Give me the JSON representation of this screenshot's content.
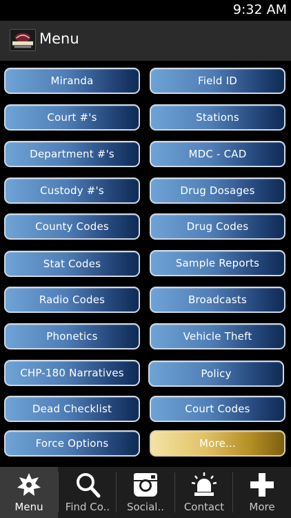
{
  "status_bar": {
    "time": "9:32 AM"
  },
  "action_bar": {
    "title": "Menu"
  },
  "menu": {
    "items": [
      "Miranda",
      "Field ID",
      "Court #'s",
      "Stations",
      "Department #'s",
      "MDC - CAD",
      "Custody #'s",
      "Drug Dosages",
      "County Codes",
      "Drug Codes",
      "Stat Codes",
      "Sample Reports",
      "Radio Codes",
      "Broadcasts",
      "Phonetics",
      "Vehicle Theft",
      "CHP-180 Narratives",
      "Policy",
      "Dead Checklist",
      "Court Codes",
      "Force Options",
      "More..."
    ],
    "normal_gradient": [
      "#6fa3d6",
      "#0f2b55"
    ],
    "highlight_gradient": [
      "#f3e3a6",
      "#7c6010"
    ]
  },
  "tabs": [
    {
      "label": "Menu",
      "icon": "star-badge-icon",
      "active": true
    },
    {
      "label": "Find Co..",
      "icon": "search-icon",
      "active": false
    },
    {
      "label": "Social..",
      "icon": "instagram-icon",
      "active": false
    },
    {
      "label": "Contact",
      "icon": "siren-icon",
      "active": false
    },
    {
      "label": "More",
      "icon": "plus-icon",
      "active": false
    }
  ]
}
